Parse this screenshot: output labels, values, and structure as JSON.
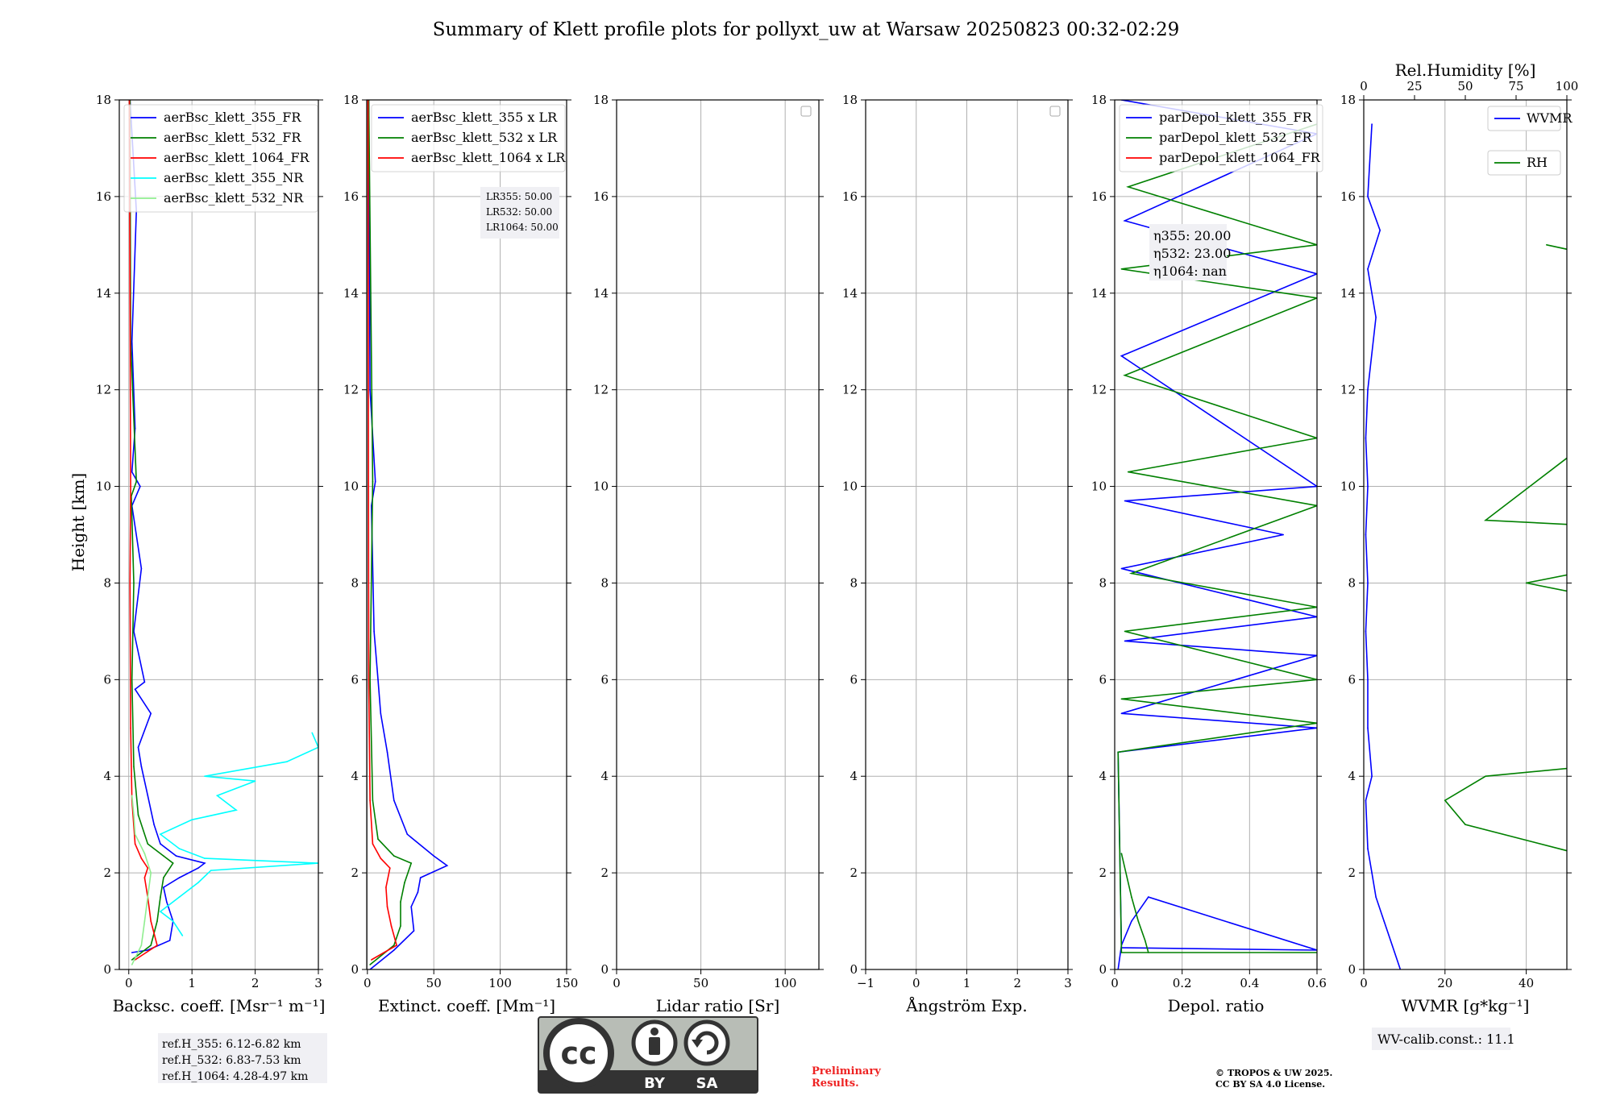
{
  "figure": {
    "title": "Summary of Klett profile plots for pollyxt_uw at Warsaw 20250823 00:32-02:29",
    "ylabel": "Height [km]"
  },
  "chart_data": [
    {
      "type": "line",
      "xlabel": "Backsc. coeff. [Msr⁻¹ m⁻¹]",
      "xlim": [
        -0.15,
        3
      ],
      "xticks": [
        0,
        1,
        2,
        3
      ],
      "ylim": [
        0,
        18
      ],
      "grid": true,
      "legend": "top-left",
      "series": [
        {
          "name": "aerBsc_klett_355_FR",
          "color": "#0000ff",
          "x": [
            0.05,
            0.3,
            0.65,
            0.7,
            0.6,
            0.55,
            0.8,
            1.1,
            1.2,
            0.75,
            0.5,
            0.4,
            0.3,
            0.2,
            0.15,
            0.35,
            0.1,
            0.25,
            0.08,
            0.2,
            0.05,
            0.18,
            0.05,
            0.1,
            0.05,
            0.12,
            0.02
          ],
          "y": [
            0.35,
            0.4,
            0.6,
            1.0,
            1.4,
            1.7,
            1.9,
            2.1,
            2.2,
            2.35,
            2.6,
            3.0,
            3.6,
            4.2,
            4.6,
            5.3,
            5.8,
            5.95,
            7.0,
            8.3,
            9.6,
            10.0,
            10.3,
            11.2,
            13.0,
            15.7,
            18.0
          ]
        },
        {
          "name": "aerBsc_klett_532_FR",
          "color": "#008000",
          "x": [
            0.05,
            0.35,
            0.45,
            0.5,
            0.55,
            0.7,
            0.55,
            0.3,
            0.15,
            0.08,
            0.05,
            0.08,
            0.04,
            0.12,
            0.03,
            0.02
          ],
          "y": [
            0.2,
            0.5,
            1.0,
            1.5,
            1.9,
            2.2,
            2.35,
            2.6,
            3.2,
            4.2,
            6.0,
            8.0,
            9.8,
            10.1,
            13.0,
            18.0
          ]
        },
        {
          "name": "aerBsc_klett_1064_FR",
          "color": "#ff0000",
          "x": [
            0.1,
            0.45,
            0.35,
            0.3,
            0.25,
            0.3,
            0.2,
            0.1,
            0.05,
            0.03,
            0.02,
            0.03,
            0.01
          ],
          "y": [
            0.2,
            0.5,
            1.0,
            1.5,
            1.9,
            2.1,
            2.3,
            2.6,
            3.5,
            5.0,
            8.0,
            10.0,
            18.0
          ]
        },
        {
          "name": "aerBsc_klett_355_NR",
          "color": "#00ffff",
          "x": [
            0.85,
            0.7,
            0.5,
            0.8,
            1.1,
            1.3,
            3.0,
            1.2,
            0.8,
            0.5,
            1.0,
            1.7,
            1.4,
            2.0,
            1.2,
            2.5,
            3.0,
            2.9
          ],
          "y": [
            0.7,
            1.0,
            1.2,
            1.5,
            1.8,
            2.05,
            2.2,
            2.3,
            2.5,
            2.8,
            3.1,
            3.3,
            3.6,
            3.9,
            4.0,
            4.3,
            4.6,
            4.9
          ]
        },
        {
          "name": "aerBsc_klett_532_NR",
          "color": "#90ee90",
          "x": [
            0.05,
            0.2,
            0.25,
            0.3,
            0.35,
            0.25,
            0.1,
            0.08,
            0.05
          ],
          "y": [
            0.1,
            0.5,
            1.0,
            1.5,
            2.0,
            2.4,
            2.8,
            3.2,
            3.6
          ]
        }
      ],
      "annotation": "ref.H_355: 6.12-6.82 km\nref.H_532: 6.83-7.53 km\nref.H_1064: 4.28-4.97 km"
    },
    {
      "type": "line",
      "xlabel": "Extinct. coeff. [Mm⁻¹]",
      "xlim": [
        -0.5,
        150
      ],
      "xticks": [
        0,
        50,
        100,
        150
      ],
      "ylim": [
        0,
        18
      ],
      "grid": true,
      "legend": "top-left",
      "series": [
        {
          "name": "aerBsc_klett_355 x LR",
          "color": "#0000ff",
          "x": [
            2,
            20,
            35,
            33,
            38,
            40,
            60,
            50,
            30,
            20,
            15,
            10,
            8,
            5,
            3,
            6,
            2,
            1
          ],
          "y": [
            0.0,
            0.4,
            0.8,
            1.3,
            1.6,
            1.9,
            2.15,
            2.35,
            2.8,
            3.5,
            4.5,
            5.3,
            6.0,
            7.0,
            9.6,
            10.1,
            12.0,
            18.0
          ]
        },
        {
          "name": "aerBsc_klett_532 x LR",
          "color": "#008000",
          "x": [
            2,
            20,
            25,
            25,
            28,
            33,
            20,
            8,
            4,
            2,
            4,
            1
          ],
          "y": [
            0.1,
            0.5,
            0.9,
            1.4,
            1.8,
            2.2,
            2.35,
            2.7,
            3.5,
            6.0,
            10.1,
            18.0
          ]
        },
        {
          "name": "aerBsc_klett_1064 x LR",
          "color": "#ff0000",
          "x": [
            3,
            22,
            18,
            15,
            14,
            17,
            10,
            4,
            2,
            1,
            0.5
          ],
          "y": [
            0.2,
            0.5,
            0.9,
            1.3,
            1.7,
            2.1,
            2.3,
            2.6,
            3.5,
            6.0,
            18.0
          ]
        }
      ],
      "annotation": "LR355: 50.00\nLR532: 50.00\nLR1064: 50.00"
    },
    {
      "type": "line",
      "xlabel": "Lidar ratio [Sr]",
      "xlim": [
        0,
        120
      ],
      "xticks": [
        0,
        50,
        100
      ],
      "ylim": [
        0,
        18
      ],
      "grid": true,
      "legend": "top-right",
      "series": []
    },
    {
      "type": "line",
      "xlabel": "Ångström Exp.",
      "xlim": [
        -1,
        3
      ],
      "xticks": [
        -1,
        0,
        1,
        2,
        3
      ],
      "ylim": [
        0,
        18
      ],
      "grid": true,
      "legend": "top-right",
      "series": []
    },
    {
      "type": "line",
      "xlabel": "Depol. ratio",
      "xlim": [
        0,
        0.6
      ],
      "xticks": [
        0.0,
        0.2,
        0.4,
        0.6
      ],
      "ylim": [
        0,
        18
      ],
      "grid": true,
      "legend": "top-left",
      "series": [
        {
          "name": "parDepol_klett_355_FR",
          "color": "#0000ff",
          "x": [
            0.01,
            0.02,
            0.05,
            0.1,
            0.6,
            0.02,
            0.01,
            0.6,
            0.02,
            0.6,
            0.03,
            0.6,
            0.02,
            0.5,
            0.03,
            0.6,
            0.02,
            0.6,
            0.03,
            0.6,
            0.02
          ],
          "y": [
            0.0,
            0.5,
            1.0,
            1.5,
            0.4,
            0.45,
            4.5,
            5.0,
            5.3,
            6.5,
            6.8,
            7.3,
            8.3,
            9.0,
            9.7,
            10.0,
            12.7,
            14.4,
            15.5,
            17.3,
            18.0
          ]
        },
        {
          "name": "parDepol_klett_532_FR",
          "color": "#008000",
          "x": [
            0.02,
            0.05,
            0.07,
            0.09,
            0.1,
            0.6,
            0.02,
            0.01,
            0.6,
            0.02,
            0.6,
            0.03,
            0.6,
            0.05,
            0.6,
            0.04,
            0.6,
            0.03,
            0.6,
            0.02,
            0.6,
            0.04,
            0.6
          ],
          "y": [
            2.4,
            1.5,
            1.0,
            0.6,
            0.35,
            0.35,
            0.35,
            4.5,
            5.1,
            5.6,
            6.0,
            7.0,
            7.5,
            8.2,
            9.6,
            10.3,
            11.0,
            12.3,
            13.9,
            14.5,
            15.0,
            16.2,
            17.5
          ]
        },
        {
          "name": "parDepol_klett_1064_FR",
          "color": "#ff0000",
          "x": [],
          "y": []
        }
      ],
      "annotation": "η355: 20.00\nη532: 23.00\nη1064: nan"
    },
    {
      "type": "line",
      "xlabel": "WVMR [g*kg⁻¹]",
      "xlim": [
        0,
        50
      ],
      "xticks": [
        0,
        20,
        40
      ],
      "secondary_xlabel": "Rel.Humidity [%]",
      "secondary_xlim": [
        0,
        100
      ],
      "secondary_xticks": [
        0,
        25,
        50,
        75,
        100
      ],
      "ylim": [
        0,
        18
      ],
      "grid": true,
      "legend": "top-right",
      "series": [
        {
          "name": "WVMR",
          "color": "#0000ff",
          "x": [
            9,
            7,
            5,
            3,
            2,
            1,
            0.5,
            2,
            1,
            1,
            0.5,
            1,
            0.5,
            1,
            0.5,
            1,
            3,
            1,
            4,
            1,
            2
          ],
          "y": [
            0.0,
            0.5,
            1.0,
            1.5,
            2.0,
            2.5,
            3.5,
            4.0,
            5.0,
            6.0,
            7.0,
            8.0,
            9.0,
            10.0,
            11.0,
            12.0,
            13.5,
            14.5,
            15.3,
            16.0,
            17.5
          ]
        },
        {
          "name": "RH",
          "color": "#008000",
          "x": [
            70,
            93,
            85,
            80,
            100,
            93,
            55,
            25,
            20,
            30,
            55,
            100,
            60,
            100,
            40,
            100,
            30,
            100,
            100,
            45
          ],
          "y": [
            0.1,
            0.5,
            1.0,
            1.5,
            2.0,
            2.3,
            2.35,
            3.0,
            3.5,
            4.0,
            4.2,
            5.0,
            6.0,
            7.0,
            8.0,
            9.0,
            9.3,
            13.8,
            14.0,
            15.0
          ]
        }
      ],
      "annotation": "WV-calib.const.: 11.1"
    }
  ],
  "footer": {
    "cc_by": "BY",
    "cc_sa": "SA",
    "cc_mark": "cc",
    "preliminary_line1": "Preliminary",
    "preliminary_line2": "Results.",
    "copyright_line1": "© TROPOS & UW 2025.",
    "copyright_line2": "CC BY SA 4.0 License."
  }
}
